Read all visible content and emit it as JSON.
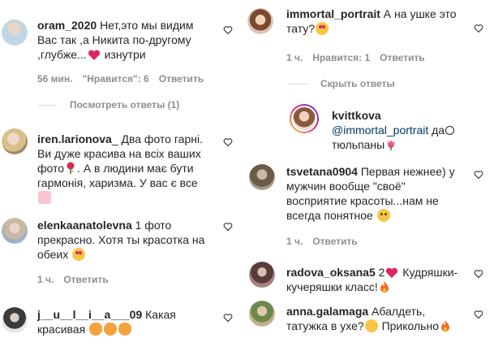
{
  "left_comments": [
    {
      "username": "oram_2020",
      "text_lines": [
        "Нет,это мы видим",
        "Вас так ,а Никита по-другому",
        ",глубже...",
        " изнутри"
      ],
      "time": "56 мин.",
      "likes": "\"Нравится\": 6",
      "reply": "Ответить",
      "view_replies": "Посмотреть ответы (1)"
    },
    {
      "username": "iren.larionova",
      "text_lines": [
        "_ Два фото гарні.",
        "Ви дуже красива на всіх ваших",
        "фото",
        ". А в людини має бути",
        "гармонія, харизма. У вас є все"
      ]
    },
    {
      "username": "elenkaanatolevna",
      "text_lines": [
        " 1 фото",
        "прекрасно. Хотя ты красотка на",
        "обеих "
      ],
      "time": "1 ч.",
      "reply": "Ответить"
    },
    {
      "username": "j__u__l__i__a___09",
      "text_lines": [
        " Какая",
        "красивая "
      ]
    }
  ],
  "right_comments": [
    {
      "username": "immortal_portrait",
      "text_lines": [
        " А на ушке это",
        "тату?"
      ],
      "time": "1 ч.",
      "likes": "Нравится: 1",
      "reply": "Ответить",
      "hide_replies": "Скрыть ответы"
    },
    {
      "username": "kvittkova",
      "mention": "@immortal_portrait",
      "text_after_mention": " да",
      "text_line2": "тюльпаны"
    },
    {
      "username": "tsvetana0904",
      "text_lines": [
        " Первая нежнее) у",
        "мужчин вообще \"своё\"",
        "восприятие красоты...нам не",
        "всегда понятное "
      ],
      "time": "1 ч.",
      "reply": "Ответить"
    },
    {
      "username": "radova_oksana5",
      "text_lines": [
        " 2",
        " Кудряшки-",
        "кучеряшки класс!"
      ]
    },
    {
      "username": "anna.galamaga",
      "text_lines": [
        " Абалдеть,",
        "татужка в ухе?",
        " Прикольно"
      ]
    }
  ],
  "colors": {
    "text": "#262626",
    "meta": "#8e8e8e",
    "mention": "#00376b",
    "divider": "#dbdbdb",
    "heart_emoji": "#e0245e",
    "face_emoji": "#f7c744"
  }
}
